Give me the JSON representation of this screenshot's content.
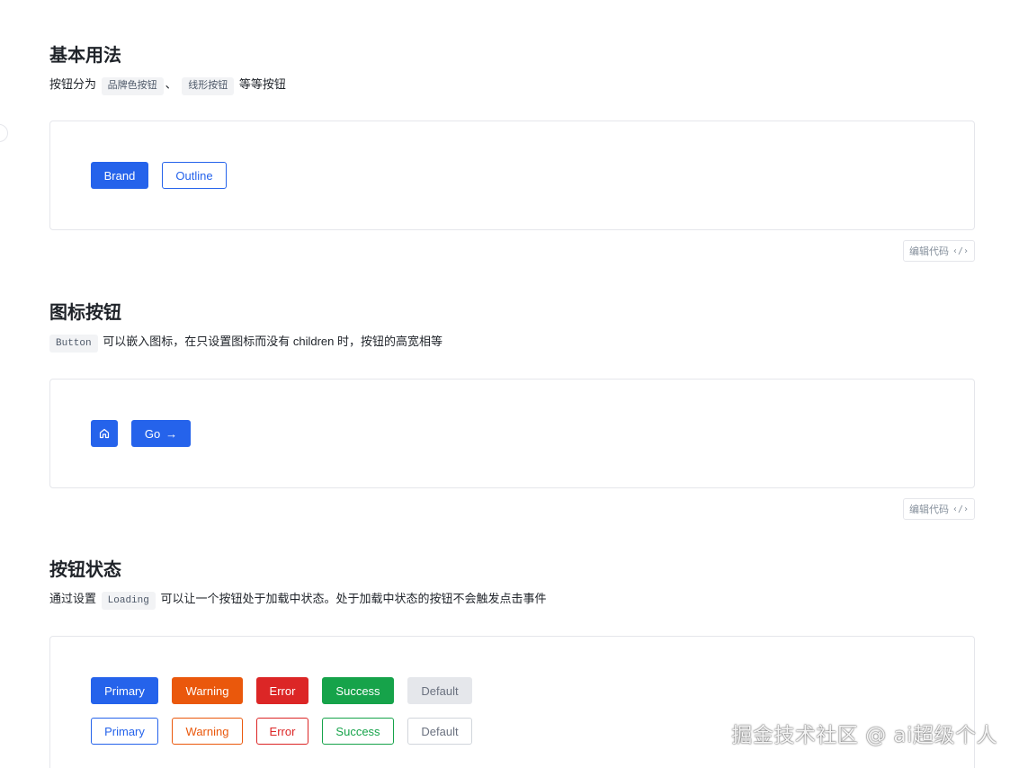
{
  "sections": {
    "basic": {
      "title": "基本用法",
      "desc_prefix": "按钮分为",
      "code_brand": "品牌色按钮",
      "desc_sep": "、",
      "code_outline": "线形按钮",
      "desc_suffix": "等等按钮",
      "buttons": {
        "brand": "Brand",
        "outline": "Outline"
      },
      "edit_label": "编辑代码"
    },
    "icon": {
      "title": "图标按钮",
      "code_button": "Button",
      "desc_rest": "可以嵌入图标，在只设置图标而没有 children 时，按钮的高宽相等",
      "buttons": {
        "go": "Go"
      },
      "icons": {
        "home": "home-icon",
        "arrow": "arrow-right-icon"
      },
      "edit_label": "编辑代码"
    },
    "state": {
      "title": "按钮状态",
      "desc_prefix": "通过设置",
      "code_loading": "Loading",
      "desc_suffix": "可以让一个按钮处于加载中状态。处于加载中状态的按钮不会触发点击事件",
      "solid_buttons": [
        "Primary",
        "Warning",
        "Error",
        "Success",
        "Default"
      ],
      "outline_buttons": [
        "Primary",
        "Warning",
        "Error",
        "Success",
        "Default"
      ]
    }
  },
  "watermark": "掘金技术社区 @ ai超级个人",
  "colors": {
    "brand": "#2563eb",
    "warning": "#ea580c",
    "error": "#dc2626",
    "success": "#16a34a",
    "default": "#e5e7eb"
  }
}
